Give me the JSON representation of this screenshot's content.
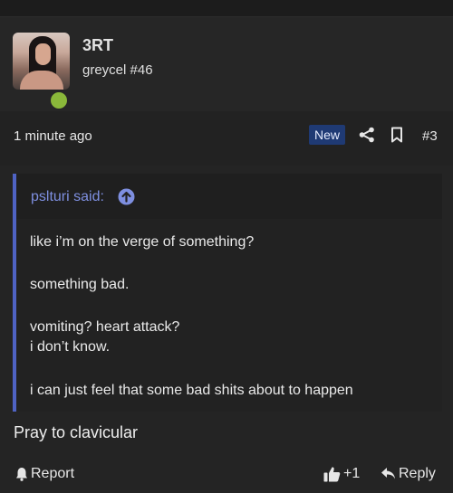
{
  "post": {
    "author": "3RT",
    "user_title": "greycel #46",
    "timestamp": "1 minute ago",
    "badge": "New",
    "post_number": "#3",
    "reply_text": "Pray to clavicular"
  },
  "quote": {
    "author_label": "pslturi said:",
    "lines": [
      "like i’m on the verge of something?",
      "something bad.",
      "vomiting? heart attack?",
      "i don’t know.",
      "i can just feel that some bad shits about to happen"
    ]
  },
  "actions": {
    "report_label": "Report",
    "like_count": "+1",
    "reply_label": "Reply"
  },
  "colors": {
    "background": "#242424",
    "accent_quote_bar": "#4f63c4",
    "quote_author": "#7e8fe0",
    "online_dot": "#8ab83a",
    "new_badge_bg": "#1f3a74"
  },
  "icons": [
    "share-icon",
    "bookmark-icon",
    "quote-jump-arrow-icon",
    "bell-icon",
    "thumbs-up-icon",
    "reply-arrow-icon"
  ]
}
